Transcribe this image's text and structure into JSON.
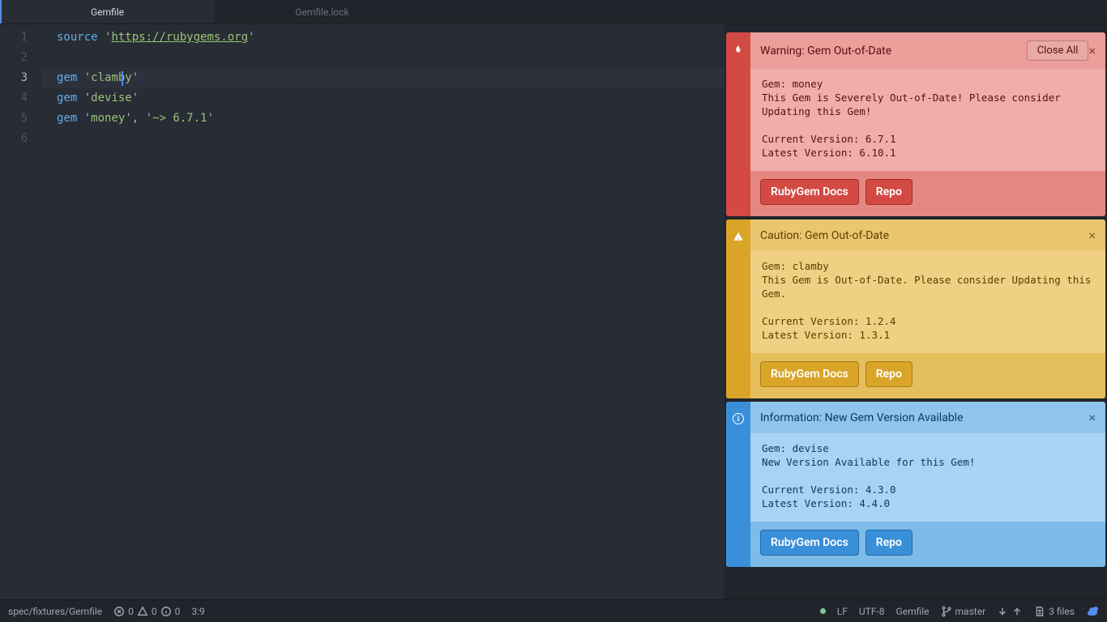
{
  "tabs": [
    {
      "label": "Gemfile",
      "active": true
    },
    {
      "label": "Gemfile.lock",
      "active": false
    }
  ],
  "editor": {
    "lines": [
      {
        "n": "1",
        "tokens": [
          [
            "kw",
            "source"
          ],
          [
            "pn",
            " '"
          ],
          [
            "url",
            "https://rubygems.org"
          ],
          [
            "pn",
            "'"
          ]
        ]
      },
      {
        "n": "2",
        "tokens": []
      },
      {
        "n": "3",
        "tokens": [
          [
            "kw",
            "gem"
          ],
          [
            "pn",
            " '"
          ],
          [
            "str",
            "clamby"
          ],
          [
            "pn",
            "'"
          ]
        ],
        "active": true
      },
      {
        "n": "4",
        "tokens": [
          [
            "kw",
            "gem"
          ],
          [
            "pn",
            " '"
          ],
          [
            "str",
            "devise"
          ],
          [
            "pn",
            "'"
          ]
        ]
      },
      {
        "n": "5",
        "tokens": [
          [
            "kw",
            "gem"
          ],
          [
            "pn",
            " '"
          ],
          [
            "str",
            "money"
          ],
          [
            "pn",
            "', '"
          ],
          [
            "str",
            "~> 6.7.1"
          ],
          [
            "pn",
            "'"
          ]
        ]
      },
      {
        "n": "6",
        "tokens": []
      }
    ]
  },
  "notifications": [
    {
      "severity": "error",
      "icon": "flame",
      "title": "Warning: Gem Out-of-Date",
      "closeAll": "Close All",
      "body": "Gem: money\nThis Gem is Severely Out-of-Date! Please consider Updating this Gem!\n\nCurrent Version: 6.7.1\nLatest Version: 6.10.1",
      "buttons": [
        "RubyGem Docs",
        "Repo"
      ]
    },
    {
      "severity": "warn",
      "icon": "alert",
      "title": "Caution: Gem Out-of-Date",
      "body": "Gem: clamby\nThis Gem is Out-of-Date. Please consider Updating this Gem.\n\nCurrent Version: 1.2.4\nLatest Version: 1.3.1",
      "buttons": [
        "RubyGem Docs",
        "Repo"
      ]
    },
    {
      "severity": "info",
      "icon": "info",
      "title": "Information: New Gem Version Available",
      "body": "Gem: devise\nNew Version Available for this Gem!\n\nCurrent Version: 4.3.0\nLatest Version: 4.4.0",
      "buttons": [
        "RubyGem Docs",
        "Repo"
      ]
    }
  ],
  "statusbar": {
    "path": "spec/fixtures/Gemfile",
    "diag_err": "0",
    "diag_warn": "0",
    "diag_info": "0",
    "cursor": "3:9",
    "line_ending": "LF",
    "encoding": "UTF-8",
    "grammar": "Gemfile",
    "branch": "master",
    "files_count": "3 files"
  }
}
